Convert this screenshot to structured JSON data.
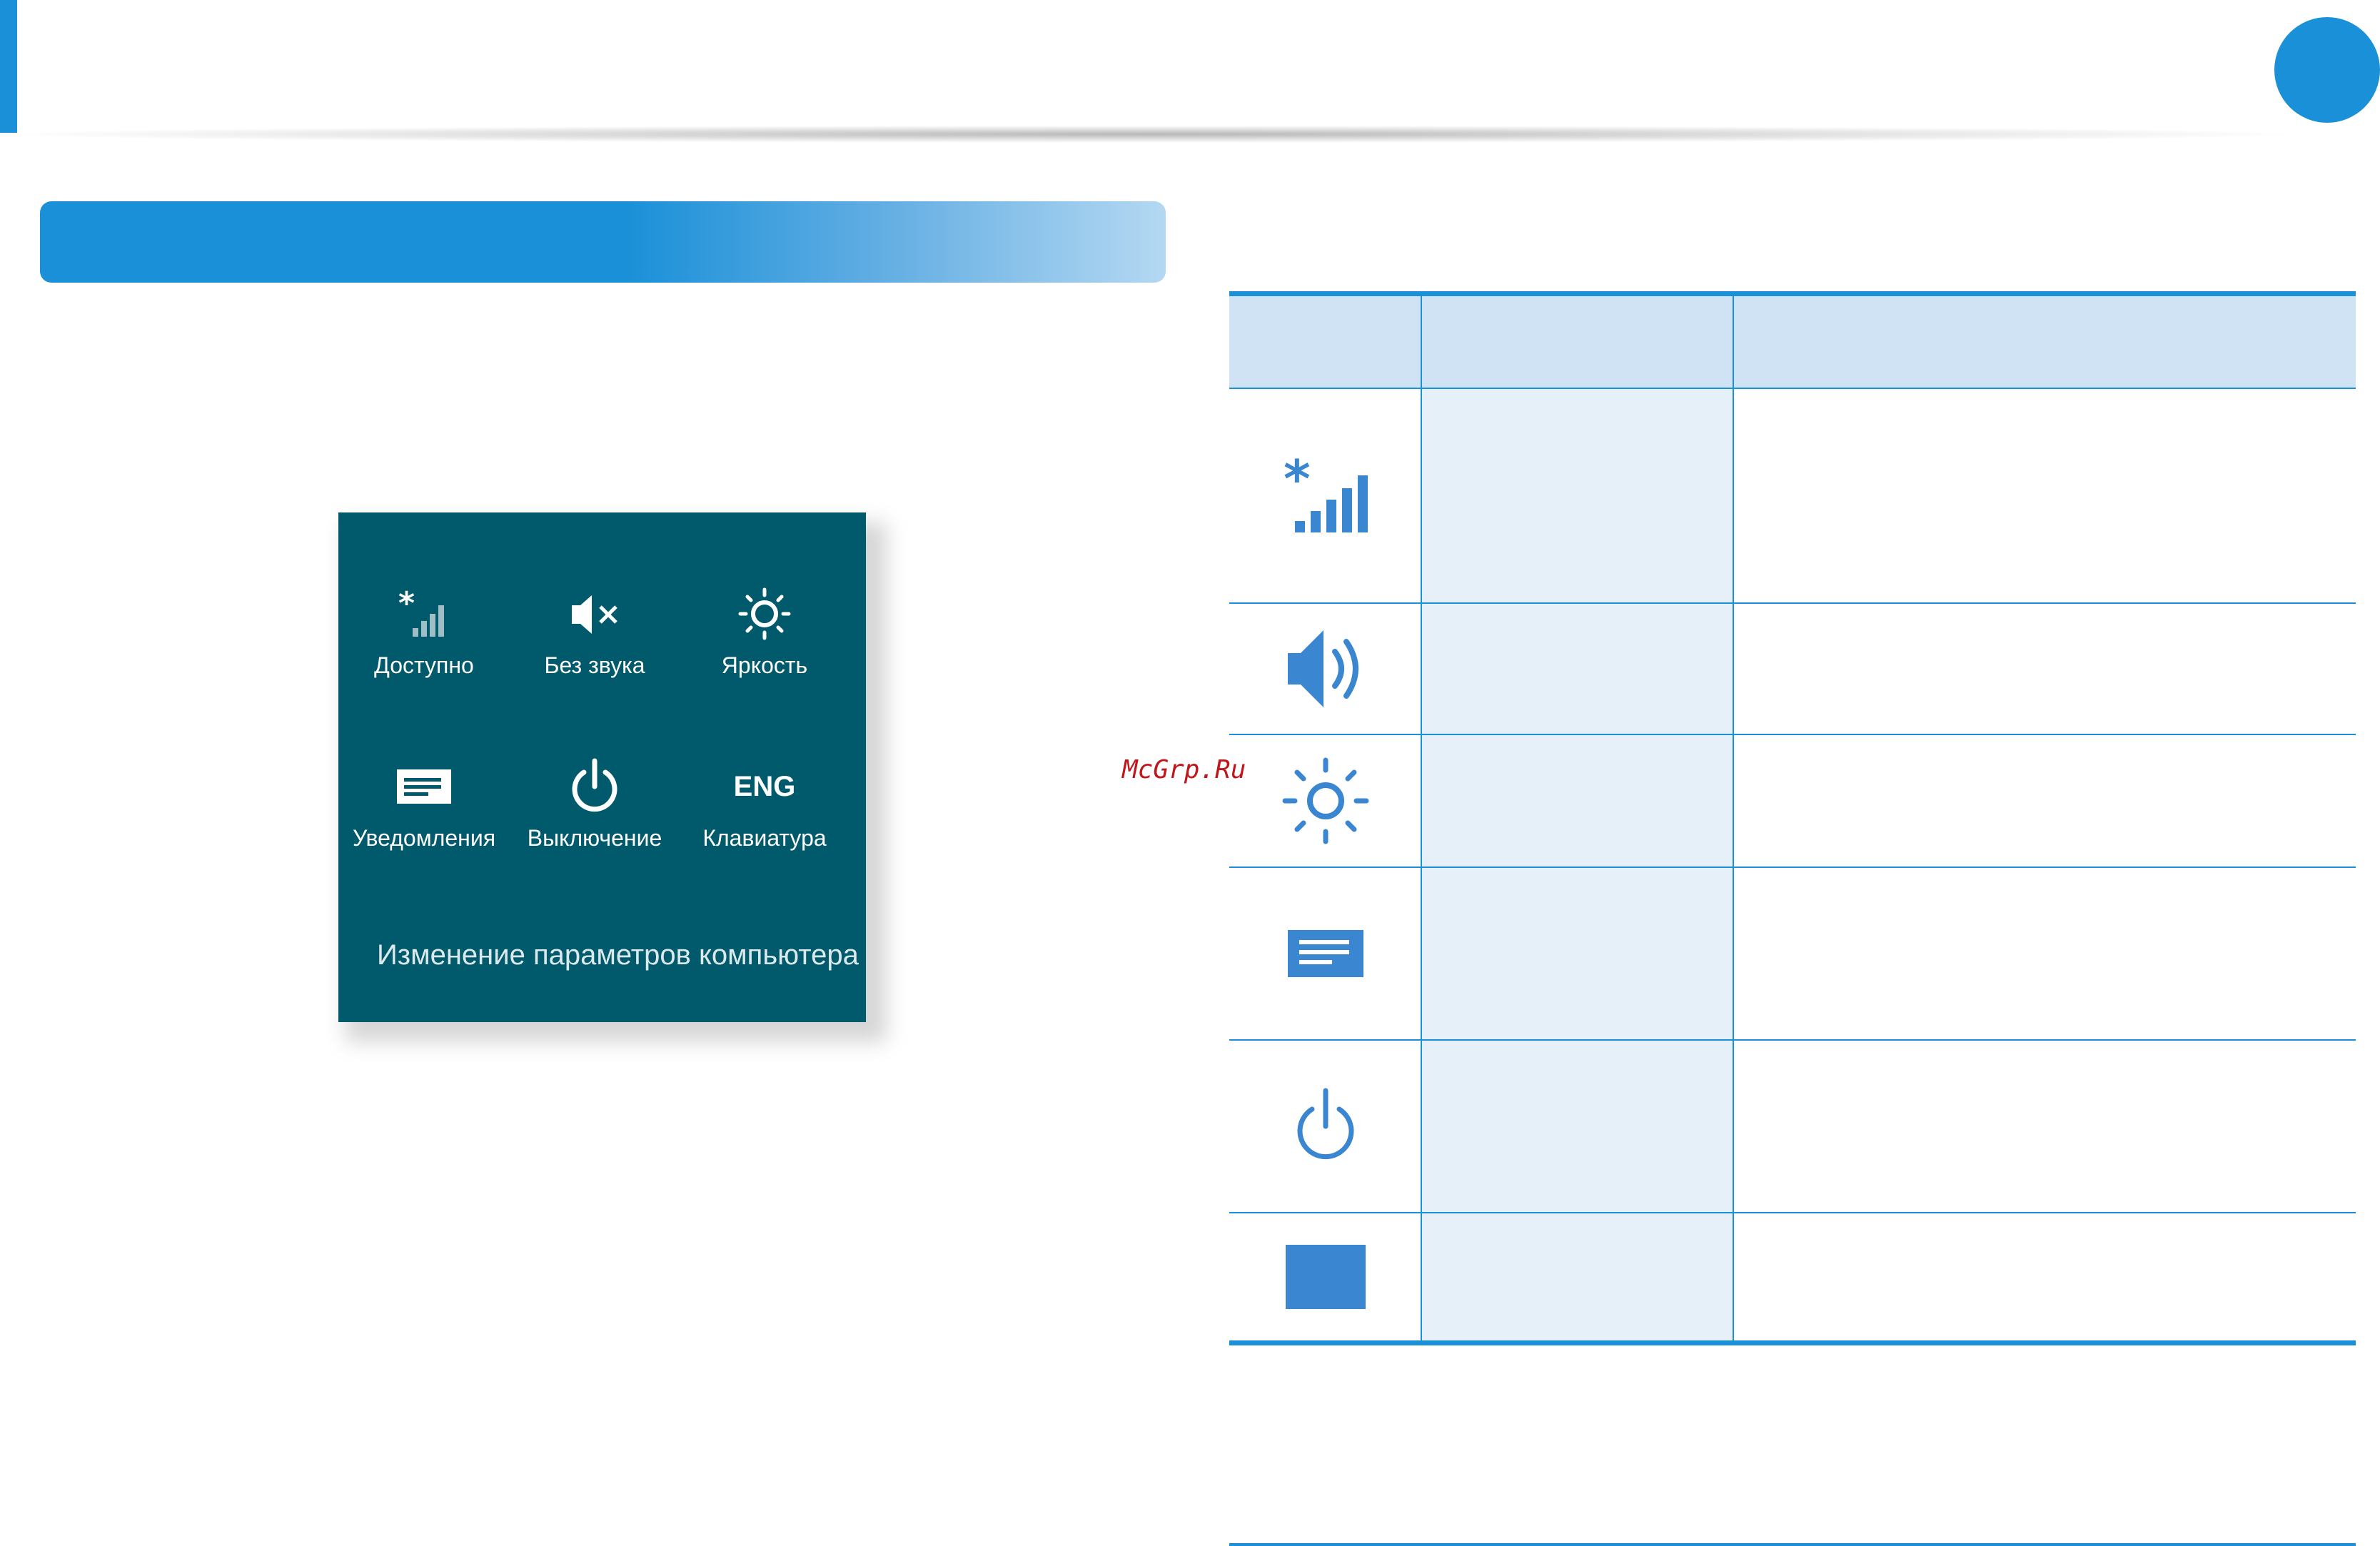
{
  "colors": {
    "accent": "#1a90d8",
    "panel_background": "#005a6b",
    "table_header": "#cfe3f5",
    "table_name_column": "#e6f0f9",
    "table_icon": "#3a86d0",
    "watermark": "#c0171c"
  },
  "settings_panel": {
    "tiles": [
      {
        "icon": "network-signal-icon",
        "label": "Доступно"
      },
      {
        "icon": "speaker-muted-icon",
        "label": "Без звука"
      },
      {
        "icon": "brightness-icon",
        "label": "Яркость"
      },
      {
        "icon": "notifications-icon",
        "label": "Уведомления"
      },
      {
        "icon": "power-icon",
        "label": "Выключение"
      },
      {
        "icon": "keyboard-language",
        "label": "Клавиатура",
        "icon_text": "ENG"
      }
    ],
    "change_settings_link": "Изменение параметров компьютера"
  },
  "watermark": "McGrp.Ru",
  "icon_table": {
    "header": [
      "",
      "",
      ""
    ],
    "rows": [
      {
        "icon": "network-signal-icon",
        "name": "",
        "description": ""
      },
      {
        "icon": "speaker-icon",
        "name": "",
        "description": ""
      },
      {
        "icon": "brightness-icon",
        "name": "",
        "description": ""
      },
      {
        "icon": "notifications-icon",
        "name": "",
        "description": ""
      },
      {
        "icon": "power-icon",
        "name": "",
        "description": ""
      },
      {
        "icon": "keyboard-square-icon",
        "name": "",
        "description": ""
      }
    ]
  }
}
